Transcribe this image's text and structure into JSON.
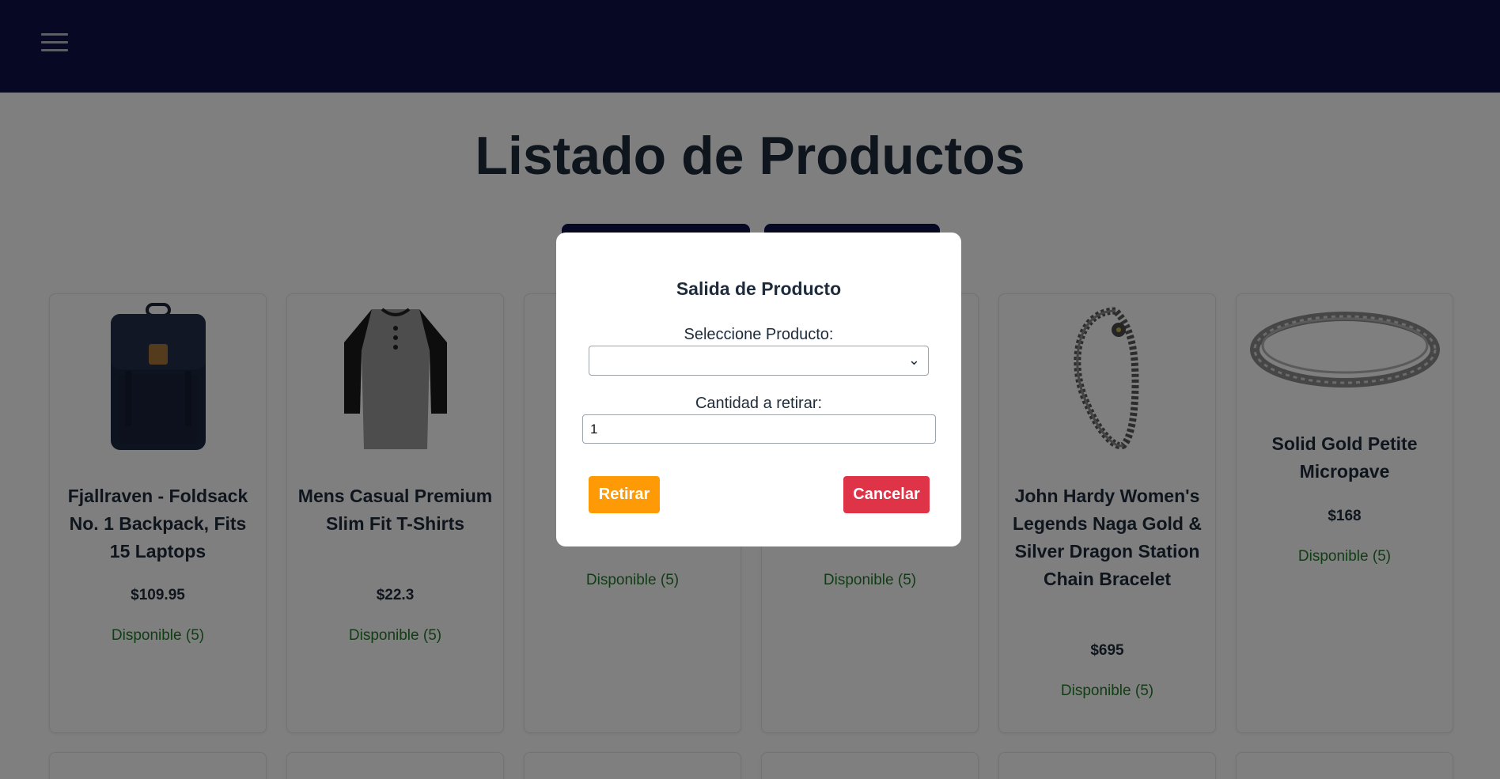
{
  "page": {
    "title": "Listado de Productos"
  },
  "header": {
    "menu_icon": "hamburger-menu-icon",
    "background": "#0c1048"
  },
  "products": [
    {
      "name": "Fjallraven - Foldsack No. 1 Backpack, Fits 15 Laptops",
      "price": "$109.95",
      "availability": "Disponible (5)"
    },
    {
      "name": "Mens Casual Premium Slim Fit T-Shirts",
      "price": "$22.3",
      "availability": "Disponible (5)"
    },
    {
      "name": "",
      "price": "",
      "availability": "Disponible (5)"
    },
    {
      "name": "",
      "price": "",
      "availability": "Disponible (5)"
    },
    {
      "name": "John Hardy Women's Legends Naga Gold & Silver Dragon Station Chain Bracelet",
      "price": "$695",
      "availability": "Disponible (5)"
    },
    {
      "name": "Solid Gold Petite Micropave",
      "price": "$168",
      "availability": "Disponible (5)"
    }
  ],
  "modal": {
    "title": "Salida de Producto",
    "select_label": "Seleccione Producto:",
    "select_value": "",
    "quantity_label": "Cantidad a retirar:",
    "quantity_value": "1",
    "withdraw_button": "Retirar",
    "cancel_button": "Cancelar"
  },
  "colors": {
    "accent_orange": "#fd9a06",
    "danger_red": "#df3347",
    "available_green": "#237a2a",
    "navy": "#0c1048"
  }
}
